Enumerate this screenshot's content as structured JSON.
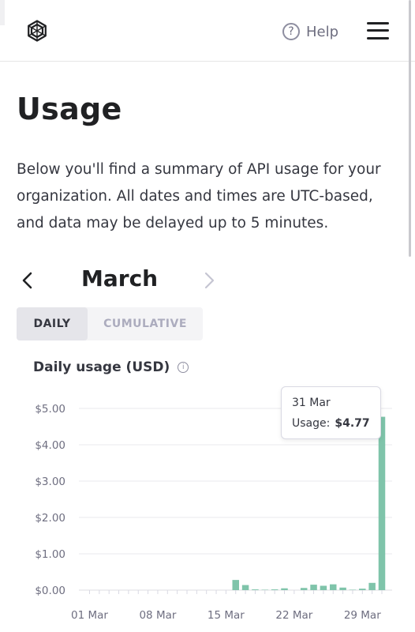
{
  "header": {
    "logo_icon": "openai-logo-icon",
    "help_label": "Help",
    "help_icon": "question-circle-icon",
    "menu_icon": "hamburger-menu-icon"
  },
  "page": {
    "title": "Usage",
    "intro": "Below you'll find a summary of API usage for your organization. All dates and times are UTC-based, and data may be delayed up to 5 minutes."
  },
  "month_nav": {
    "prev_icon": "chevron-left-icon",
    "month": "March",
    "next_icon": "chevron-right-icon"
  },
  "view_toggle": {
    "options": [
      "DAILY",
      "CUMULATIVE"
    ],
    "selected": "DAILY"
  },
  "chart_section": {
    "title": "Daily usage (USD)",
    "info_icon": "info-circle-icon"
  },
  "tooltip": {
    "date": "31 Mar",
    "label": "Usage:",
    "value": "$4.77"
  },
  "colors": {
    "bar": "#7fc4aa",
    "grid": "#e8e8ec",
    "text": "#202123"
  },
  "chart_data": {
    "type": "bar",
    "title": "Daily usage (USD)",
    "xlabel": "",
    "ylabel": "",
    "ylim": [
      0,
      5
    ],
    "yticks": [
      "$0.00",
      "$1.00",
      "$2.00",
      "$3.00",
      "$4.00",
      "$5.00"
    ],
    "xtick_labels": [
      "01 Mar",
      "08 Mar",
      "15 Mar",
      "22 Mar",
      "29 Mar"
    ],
    "categories": [
      "01 Mar",
      "02 Mar",
      "03 Mar",
      "04 Mar",
      "05 Mar",
      "06 Mar",
      "07 Mar",
      "08 Mar",
      "09 Mar",
      "10 Mar",
      "11 Mar",
      "12 Mar",
      "13 Mar",
      "14 Mar",
      "15 Mar",
      "16 Mar",
      "17 Mar",
      "18 Mar",
      "19 Mar",
      "20 Mar",
      "21 Mar",
      "22 Mar",
      "23 Mar",
      "24 Mar",
      "25 Mar",
      "26 Mar",
      "27 Mar",
      "28 Mar",
      "29 Mar",
      "30 Mar",
      "31 Mar"
    ],
    "values": [
      0,
      0,
      0,
      0,
      0,
      0,
      0,
      0,
      0,
      0,
      0,
      0,
      0,
      0,
      0,
      0.28,
      0.14,
      0.02,
      0.01,
      0.02,
      0.05,
      0,
      0.06,
      0.15,
      0.12,
      0.16,
      0.07,
      0.01,
      0.04,
      0.2,
      4.77
    ],
    "grid": true,
    "legend": "none"
  }
}
